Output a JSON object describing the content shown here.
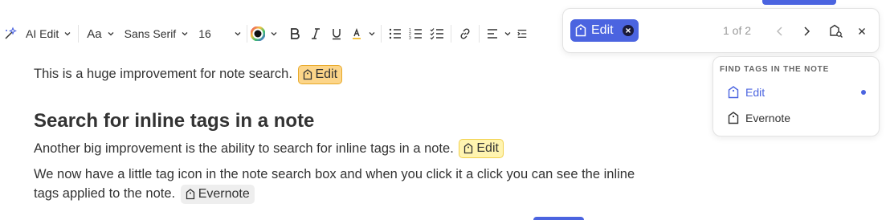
{
  "toolbar": {
    "ai_edit_label": "AI Edit",
    "format_label": "Aa",
    "font_family": "Sans Serif",
    "font_size": "16"
  },
  "content": {
    "line1": "This is a huge improvement for note search.",
    "line1_tag": "Edit",
    "heading": "Search for inline tags in a note",
    "line2": "Another big improvement is the ability to search for inline tags in a note.",
    "line2_tag": "Edit",
    "line3": "We now have a little tag icon in the note search box and when you click it a click you can see the inline tags applied to the note.",
    "line3_tag": "Evernote"
  },
  "search": {
    "chip_label": "Edit",
    "count": "1 of 2"
  },
  "dropdown": {
    "title": "FIND TAGS IN THE NOTE",
    "items": [
      {
        "label": "Edit",
        "selected": true
      },
      {
        "label": "Evernote",
        "selected": false
      }
    ]
  },
  "colors": {
    "accent": "#4b64e0",
    "tag_active_bg": "#fcd589",
    "tag_match_bg": "#fff4b0",
    "tag_plain_bg": "#eeeeee"
  }
}
